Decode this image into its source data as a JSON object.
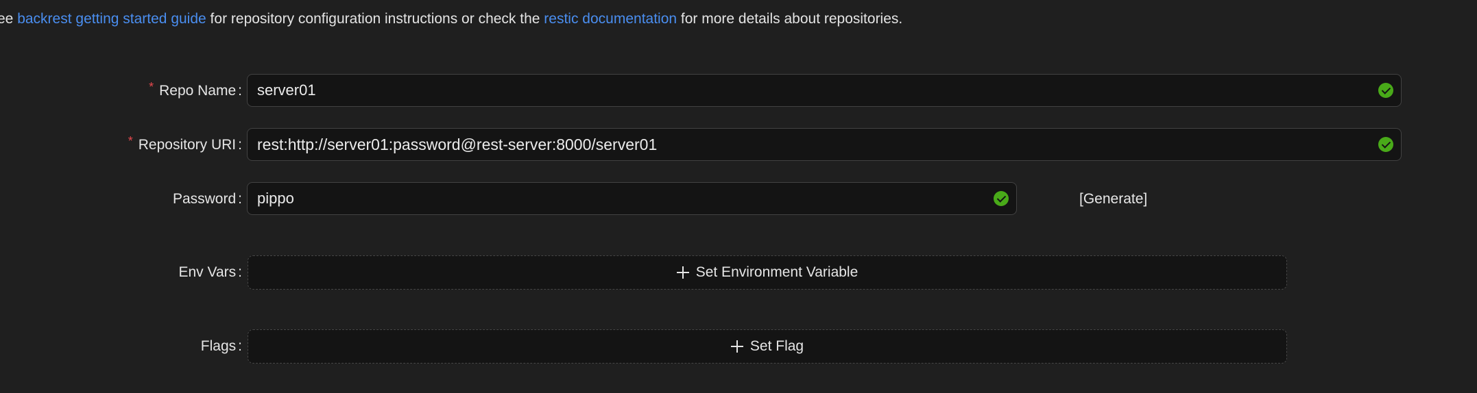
{
  "intro": {
    "prefix": "ee ",
    "link1": "backrest getting started guide",
    "middle": " for repository configuration instructions or check the ",
    "link2": "restic documentation",
    "suffix": " for more details about repositories."
  },
  "form": {
    "repo_name": {
      "label": "Repo Name",
      "required": true,
      "value": "server01"
    },
    "repository_uri": {
      "label": "Repository URI",
      "required": true,
      "value": "rest:http://server01:password@rest-server:8000/server01"
    },
    "password": {
      "label": "Password",
      "value": "pippo",
      "generate_label": "[Generate]"
    },
    "env_vars": {
      "label": "Env Vars",
      "button_label": "Set Environment Variable"
    },
    "flags": {
      "label": "Flags",
      "button_label": "Set Flag"
    }
  },
  "colors": {
    "background": "#1f1f1f",
    "input_bg": "#141414",
    "link": "#4a8ef0",
    "success": "#49aa19",
    "required": "#e5484d"
  },
  "icons": {
    "valid": "check-circle-icon",
    "add": "plus-icon"
  }
}
